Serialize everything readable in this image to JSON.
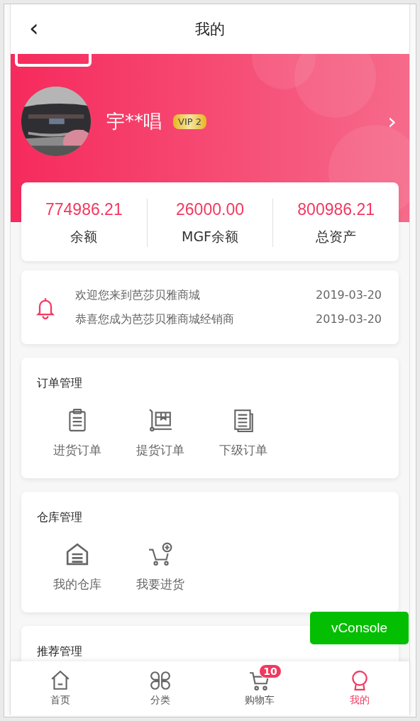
{
  "header": {
    "back": "‹",
    "title": "我的"
  },
  "profile": {
    "name": "宇**唱",
    "vip": "VIP 2",
    "chevron": "›"
  },
  "stats": [
    {
      "value": "774986.21",
      "label": "余额"
    },
    {
      "value": "26000.00",
      "label": "MGF余额"
    },
    {
      "value": "800986.21",
      "label": "总资产"
    }
  ],
  "notices": [
    {
      "text": "欢迎您来到芭莎贝雅商城",
      "date": "2019-03-20"
    },
    {
      "text": "恭喜您成为芭莎贝雅商城经销商",
      "date": "2019-03-20"
    }
  ],
  "sections": [
    {
      "title": "订单管理",
      "items": [
        {
          "label": "进货订单",
          "kind": "clipboard"
        },
        {
          "label": "提货订单",
          "kind": "trolley"
        },
        {
          "label": "下级订单",
          "kind": "documents"
        }
      ]
    },
    {
      "title": "仓库管理",
      "items": [
        {
          "label": "我的仓库",
          "kind": "warehouse"
        },
        {
          "label": "我要进货",
          "kind": "cart-add"
        }
      ]
    },
    {
      "title": "推荐管理"
    }
  ],
  "tabs": [
    {
      "label": "首页",
      "kind": "home",
      "selected": false
    },
    {
      "label": "分类",
      "kind": "grid",
      "selected": false
    },
    {
      "label": "购物车",
      "kind": "cart",
      "selected": false,
      "badge": "10"
    },
    {
      "label": "我的",
      "kind": "user",
      "selected": true
    }
  ],
  "vconsole": "vConsole"
}
